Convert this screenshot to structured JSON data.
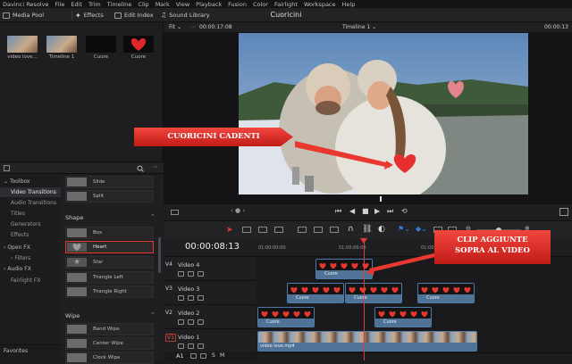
{
  "menubar": {
    "items": [
      "Davinci Resolve",
      "File",
      "Edit",
      "Trim",
      "Timeline",
      "Clip",
      "Mark",
      "View",
      "Playback",
      "Fusion",
      "Color",
      "Fairlight",
      "Workspace",
      "Help"
    ]
  },
  "toolbar": {
    "media_pool": "Media Pool",
    "effects": "Effects",
    "edit_index": "Edit Index",
    "sound_library": "Sound Library",
    "project_title": "Cuoricini"
  },
  "media_pool": {
    "clips": [
      {
        "label": "video love..."
      },
      {
        "label": "Timeline 1"
      },
      {
        "label": "Cuore"
      },
      {
        "label": "Cuore"
      }
    ]
  },
  "toolbox": {
    "items": [
      {
        "label": "Toolbox",
        "expanded": true
      },
      {
        "label": "Video Transitions",
        "selected": true
      },
      {
        "label": "Audio Transitions"
      },
      {
        "label": "Titles"
      },
      {
        "label": "Generators"
      },
      {
        "label": "Effects"
      },
      {
        "label": "Open FX",
        "expanded": false
      },
      {
        "label": "Filters"
      },
      {
        "label": "Audio FX",
        "expanded": false
      },
      {
        "label": "Fairlight FX"
      }
    ],
    "favorites": "Favorites"
  },
  "effects_list": {
    "top_items": [
      "Slide",
      "Split"
    ],
    "shape_header": "Shape",
    "shape_items": [
      "Box",
      "Heart",
      "Star",
      "Triangle Left",
      "Triangle Right"
    ],
    "wipe_header": "Wipe",
    "wipe_items": [
      "Band Wipe",
      "Center Wipe",
      "Clock Wipe"
    ]
  },
  "viewer": {
    "fit": "Fit",
    "timecode_left": "00:00:17:08",
    "timeline_name": "Timeline 1",
    "timecode_right": "00:00:13"
  },
  "timeline": {
    "timecode": "00:00:08:13",
    "ruler": [
      "01:00:00:00",
      "01:00:06:00",
      "01:00:12:00"
    ],
    "tracks": [
      {
        "id": "V4",
        "name": "Video 4"
      },
      {
        "id": "V3",
        "name": "Video 3"
      },
      {
        "id": "V2",
        "name": "Video 2"
      },
      {
        "id": "V1",
        "name": "Video 1"
      },
      {
        "id": "A1",
        "name": ""
      }
    ],
    "clip_cuore": "Cuore",
    "clip_video": "video love.mp4"
  },
  "annotations": {
    "cuoricini": "CUORICINI CADENTI",
    "clip_line1": "CLIP AGGIUNTE",
    "clip_line2": "SOPRA AL VIDEO"
  },
  "colors": {
    "accent_red": "#e8382f",
    "playhead": "#e23b3b",
    "clip_blue": "#4f7396"
  }
}
